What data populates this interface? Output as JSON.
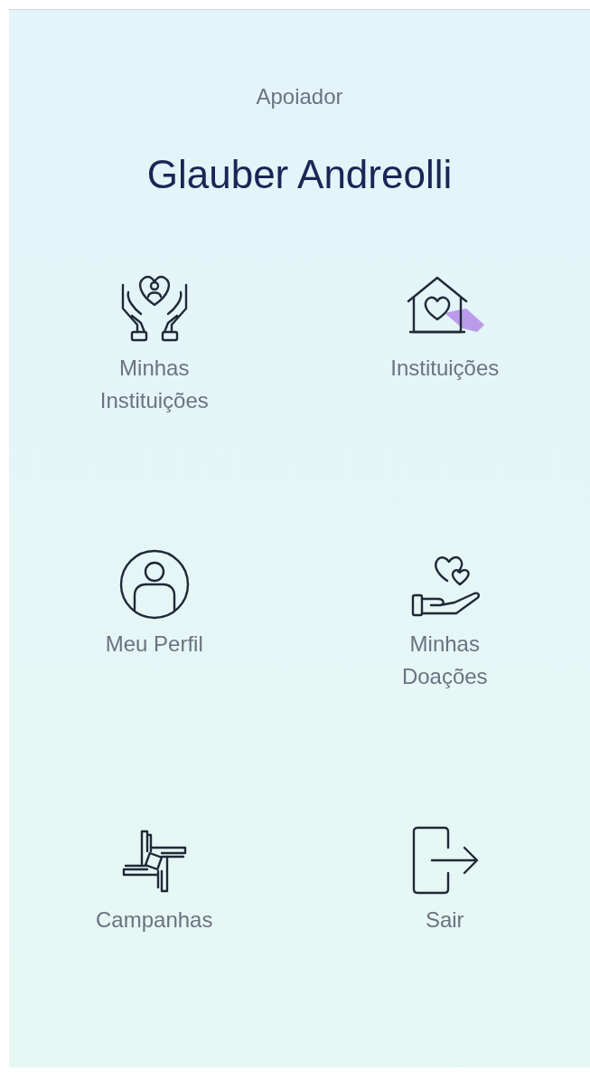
{
  "header": {
    "role": "Apoiador",
    "name": "Glauber Andreolli"
  },
  "menu": [
    {
      "label": "Minhas Instituições"
    },
    {
      "label": "Instituições"
    },
    {
      "label": "Meu Perfil"
    },
    {
      "label": "Minhas Doações"
    },
    {
      "label": "Campanhas"
    },
    {
      "label": "Sair"
    }
  ]
}
